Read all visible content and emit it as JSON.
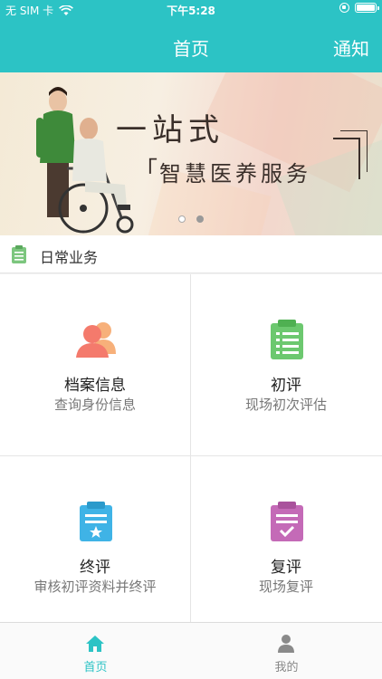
{
  "status_bar": {
    "carrier": "无 SIM 卡",
    "time": "下午5:28"
  },
  "nav": {
    "title": "首页",
    "right_action": "通知"
  },
  "banner": {
    "headline": "一站式",
    "bracket_left": "「",
    "subtitle": "智慧医养服务",
    "page_count": 2,
    "active_page": 1
  },
  "section": {
    "title": "日常业务"
  },
  "grid": [
    {
      "title": "档案信息",
      "subtitle": "查询身份信息",
      "icon": "people-icon",
      "color": "#f47a6c"
    },
    {
      "title": "初评",
      "subtitle": "现场初次评估",
      "icon": "clipboard-list-icon",
      "color": "#6cc86f"
    },
    {
      "title": "终评",
      "subtitle": "审核初评资料并终评",
      "icon": "clipboard-star-icon",
      "color": "#3fb3e6"
    },
    {
      "title": "复评",
      "subtitle": "现场复评",
      "icon": "clipboard-check-icon",
      "color": "#c46ab7"
    }
  ],
  "tabbar": {
    "home": "首页",
    "mine": "我的"
  },
  "colors": {
    "accent": "#2cc3c5",
    "inactive": "#888888"
  }
}
